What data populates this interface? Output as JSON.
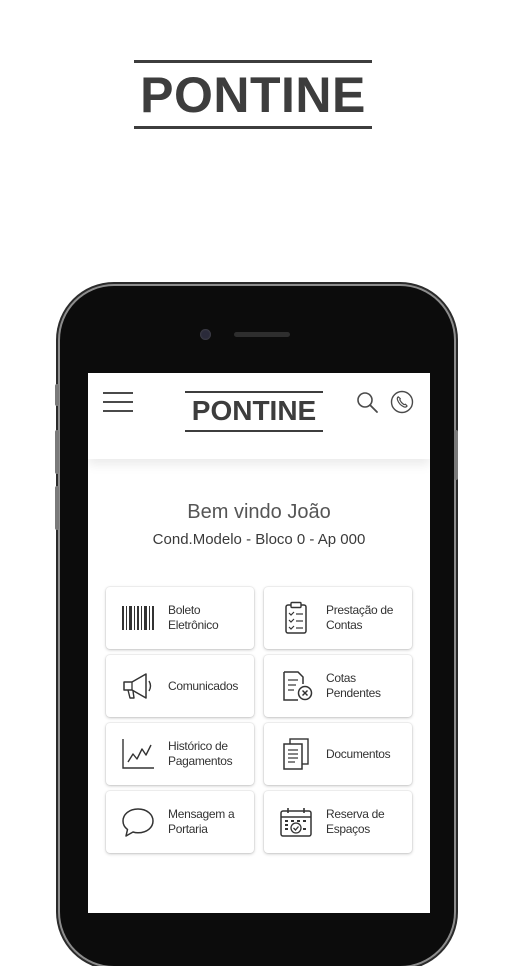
{
  "brand": {
    "name": "PONTINE"
  },
  "header": {
    "logo": "PONTINE",
    "menu_icon": "hamburger-menu-icon",
    "search_icon": "search-icon",
    "phone_icon": "phone-icon"
  },
  "greeting": {
    "welcome": "Bem vindo João",
    "unit": "Cond.Modelo - Bloco 0 - Ap 000"
  },
  "tiles": [
    {
      "label_line1": "Boleto",
      "label_line2": "Eletrônico",
      "icon": "barcode-icon"
    },
    {
      "label_line1": "Prestação de",
      "label_line2": "Contas",
      "icon": "clipboard-checklist-icon"
    },
    {
      "label_line1": "Comunicados",
      "label_line2": "",
      "icon": "megaphone-icon"
    },
    {
      "label_line1": "Cotas",
      "label_line2": "Pendentes",
      "icon": "document-x-icon"
    },
    {
      "label_line1": "Histórico de",
      "label_line2": "Pagamentos",
      "icon": "line-chart-icon"
    },
    {
      "label_line1": "Documentos",
      "label_line2": "",
      "icon": "documents-icon"
    },
    {
      "label_line1": "Mensagem a",
      "label_line2": "Portaria",
      "icon": "speech-bubble-icon"
    },
    {
      "label_line1": "Reserva de",
      "label_line2": "Espaços",
      "icon": "calendar-check-icon"
    }
  ],
  "colors": {
    "text": "#3d3d3d",
    "phone_body": "#0c0c0c",
    "background": "#ffffff"
  }
}
